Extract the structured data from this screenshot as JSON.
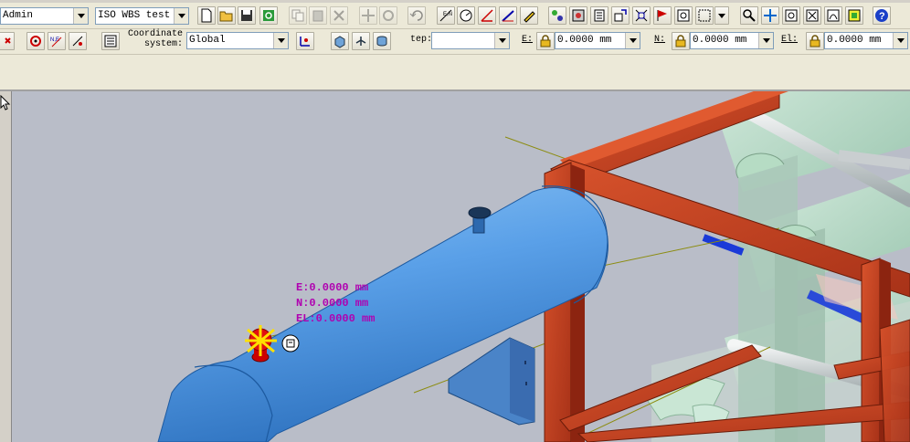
{
  "toolbar1": {
    "user_combo": "Admin",
    "wbs_combo": "ISO WBS test"
  },
  "toolbar2": {
    "coord_label_line1": "Coordinate",
    "coord_label_line2": "system:",
    "coord_system": "Global",
    "step_label": "tep:",
    "step_value": "",
    "e_label": "E:",
    "e_value": "0.0000 mm",
    "n_label": "N:",
    "n_value": "0.0000 mm",
    "el_label": "El:",
    "el_value": "0.0000 mm"
  },
  "viewport": {
    "readout_e": "E:0.0000 mm",
    "readout_n": "N:0.0000 mm",
    "readout_el": "EL:0.0000 mm"
  },
  "colors": {
    "vessel": "#5aa0e8",
    "steel": "#c8401e",
    "background": "#b9bdc8",
    "readout": "#b000b0"
  }
}
